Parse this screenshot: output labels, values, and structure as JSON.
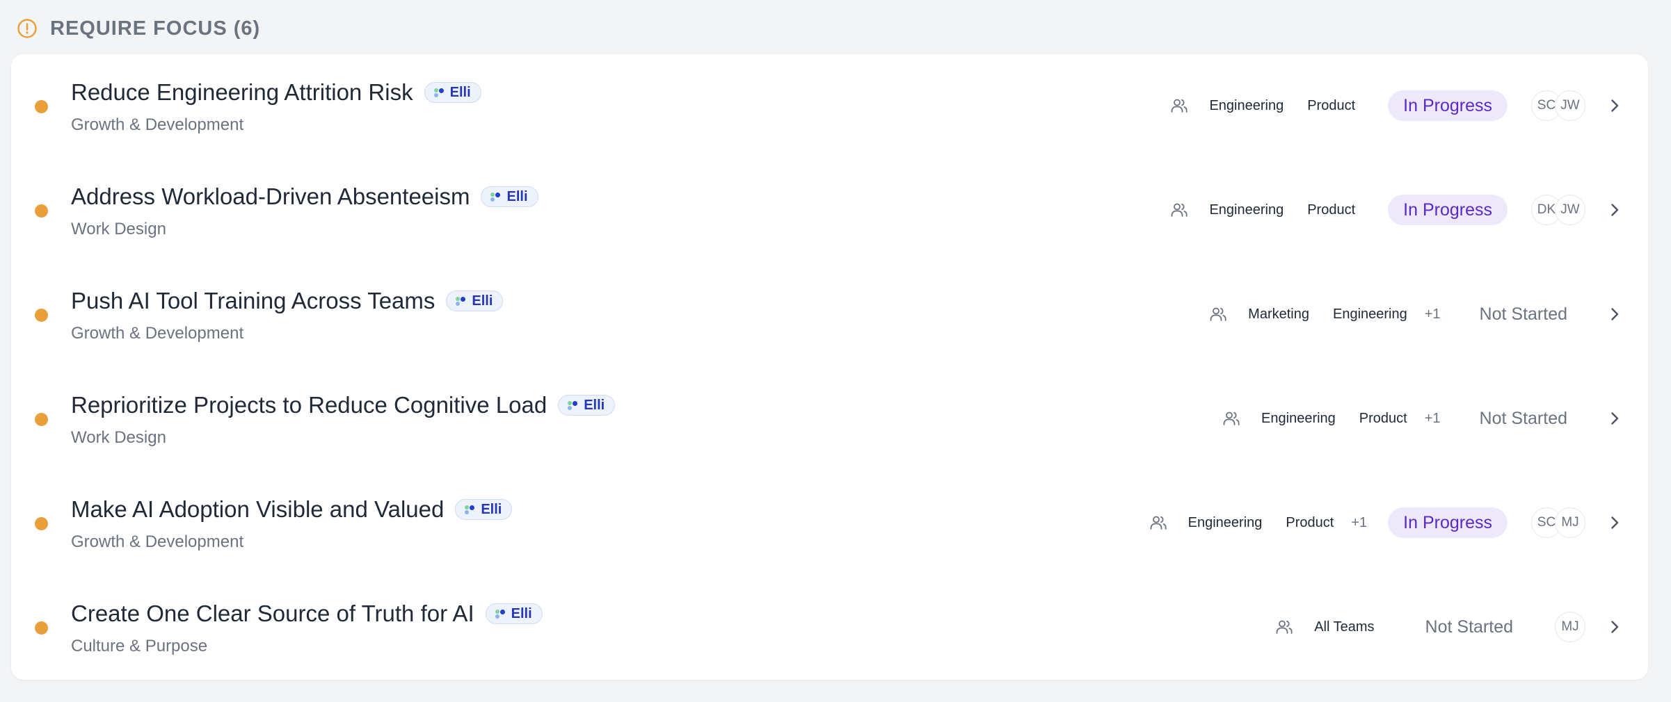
{
  "header": {
    "title": "REQUIRE FOCUS (6)",
    "icon": "alert-circle-icon",
    "accent": "#e9a03b"
  },
  "colors": {
    "priority_dot": "#e9a03b",
    "in_progress_bg": "#ede9fb",
    "in_progress_text": "#5b28c8",
    "elli_text": "#2436b8"
  },
  "rows": [
    {
      "title": "Reduce Engineering Attrition Risk",
      "badge": "Elli",
      "category": "Growth & Development",
      "teams": [
        "Engineering",
        "Product"
      ],
      "more": "",
      "status": "In Progress",
      "avatars": [
        "SC",
        "JW"
      ]
    },
    {
      "title": "Address Workload-Driven Absenteeism",
      "badge": "Elli",
      "category": "Work Design",
      "teams": [
        "Engineering",
        "Product"
      ],
      "more": "",
      "status": "In Progress",
      "avatars": [
        "DK",
        "JW"
      ]
    },
    {
      "title": "Push AI Tool Training Across Teams",
      "badge": "Elli",
      "category": "Growth & Development",
      "teams": [
        "Marketing",
        "Engineering"
      ],
      "more": "+1",
      "status": "Not Started",
      "avatars": []
    },
    {
      "title": "Reprioritize Projects to Reduce Cognitive Load",
      "badge": "Elli",
      "category": "Work Design",
      "teams": [
        "Engineering",
        "Product"
      ],
      "more": "+1",
      "status": "Not Started",
      "avatars": []
    },
    {
      "title": "Make AI Adoption Visible and Valued",
      "badge": "Elli",
      "category": "Growth & Development",
      "teams": [
        "Engineering",
        "Product"
      ],
      "more": "+1",
      "status": "In Progress",
      "avatars": [
        "SC",
        "MJ"
      ]
    },
    {
      "title": "Create One Clear Source of Truth for AI",
      "badge": "Elli",
      "category": "Culture & Purpose",
      "teams": [
        "All Teams"
      ],
      "more": "",
      "status": "Not Started",
      "avatars": [
        "MJ"
      ]
    }
  ]
}
